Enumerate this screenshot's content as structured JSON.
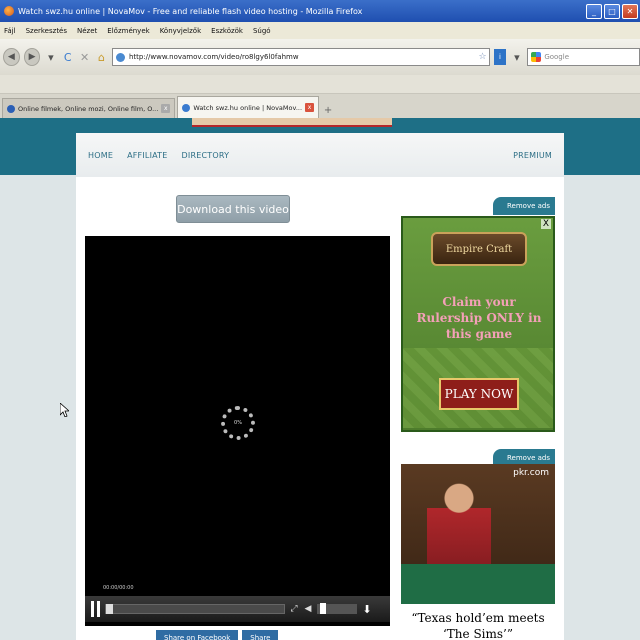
{
  "window": {
    "title": "Watch swz.hu online | NovaMov - Free and reliable flash video hosting - Mozilla Firefox",
    "min": "_",
    "max": "□",
    "close": "✕"
  },
  "menu": [
    "Fájl",
    "Szerkesztés",
    "Nézet",
    "Előzmények",
    "Könyvjelzők",
    "Eszközök",
    "Súgó"
  ],
  "nav": {
    "url": "http://www.novamov.com/video/ro8lgy6l0fahmw",
    "search_placeholder": "Google",
    "back": "◀",
    "forward": "▶",
    "dropdown": "▾",
    "reload": "C",
    "stop": "✕",
    "home": "⌂",
    "star": "☆"
  },
  "tabs": [
    {
      "label": "Online filmek, Online mozi, Online film, O...",
      "active": false
    },
    {
      "label": "Watch swz.hu online | NovaMov...",
      "active": true
    }
  ],
  "tab_close": "x",
  "newtab": "+",
  "site": {
    "nav_links": [
      "HOME",
      "AFFILIATE",
      "DIRECTORY"
    ],
    "premium": "PREMIUM",
    "download_button": "Download this video",
    "player": {
      "loading_percent": "0%",
      "timecode": "00:00/00:00",
      "progress": 0,
      "volume": 0.1
    },
    "remove_ads": "Remove ads",
    "ad1": {
      "logo": "Empire Craft",
      "claim": "Claim your Rulership ONLY in this game",
      "cta": "PLAY NOW",
      "close": "X"
    },
    "ad2": {
      "brand": "pkr.com",
      "caption": "“Texas hold’em meets ‘The Sims’”"
    },
    "share": [
      "Share on Facebook",
      "Share"
    ]
  }
}
